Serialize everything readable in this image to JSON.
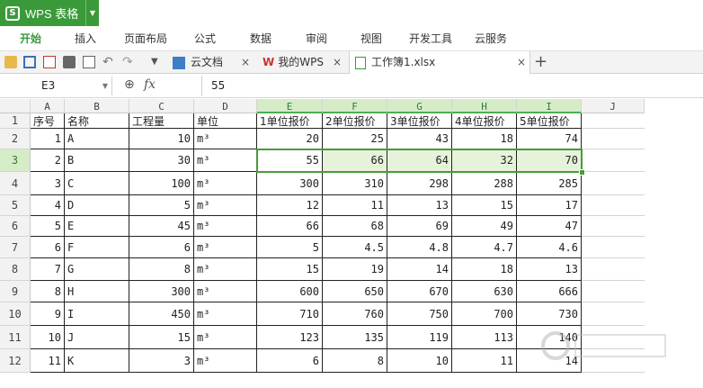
{
  "app": {
    "title": "WPS 表格",
    "accent": "#3a9a3a"
  },
  "menu": [
    "开始",
    "插入",
    "页面布局",
    "公式",
    "数据",
    "审阅",
    "视图",
    "开发工具",
    "云服务"
  ],
  "tabs": [
    {
      "label": "云文档"
    },
    {
      "label": "我的WPS"
    },
    {
      "label": "工作簿1.xlsx"
    }
  ],
  "formula_bar": {
    "cell_ref": "E3",
    "fx": "fx",
    "value": "55"
  },
  "columns": [
    "A",
    "B",
    "C",
    "D",
    "E",
    "F",
    "G",
    "H",
    "I",
    "J"
  ],
  "header_row": [
    "序号",
    "名称",
    "工程量",
    "单位",
    "1单位报价",
    "2单位报价",
    "3单位报价",
    "4单位报价",
    "5单位报价"
  ],
  "rows": [
    [
      "1",
      "A",
      "10",
      "m³",
      "20",
      "25",
      "43",
      "18",
      "74"
    ],
    [
      "2",
      "B",
      "30",
      "m³",
      "55",
      "66",
      "64",
      "32",
      "70"
    ],
    [
      "3",
      "C",
      "100",
      "m³",
      "300",
      "310",
      "298",
      "288",
      "285"
    ],
    [
      "4",
      "D",
      "5",
      "m³",
      "12",
      "11",
      "13",
      "15",
      "17"
    ],
    [
      "5",
      "E",
      "45",
      "m³",
      "66",
      "68",
      "69",
      "49",
      "47"
    ],
    [
      "6",
      "F",
      "6",
      "m³",
      "5",
      "4.5",
      "4.8",
      "4.7",
      "4.6"
    ],
    [
      "7",
      "G",
      "8",
      "m³",
      "15",
      "19",
      "14",
      "18",
      "13"
    ],
    [
      "8",
      "H",
      "300",
      "m³",
      "600",
      "650",
      "670",
      "630",
      "666"
    ],
    [
      "9",
      "I",
      "450",
      "m³",
      "710",
      "760",
      "750",
      "700",
      "730"
    ],
    [
      "10",
      "J",
      "15",
      "m³",
      "123",
      "135",
      "119",
      "113",
      "140"
    ],
    [
      "11",
      "K",
      "3",
      "m³",
      "6",
      "8",
      "10",
      "11",
      "14"
    ]
  ],
  "row_numbers": [
    "1",
    "2",
    "3",
    "4",
    "5",
    "6",
    "7",
    "8",
    "9",
    "10",
    "11",
    "12"
  ]
}
